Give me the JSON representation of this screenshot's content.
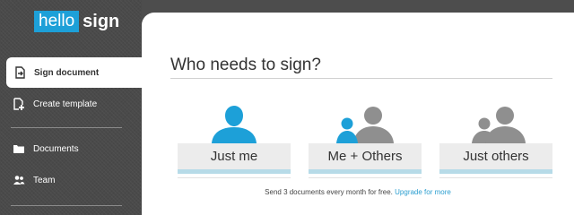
{
  "logo": {
    "box_text": "hello",
    "word_text": "sign"
  },
  "sidebar": {
    "items": [
      {
        "label": "Sign document",
        "icon": "sign-document-icon"
      },
      {
        "label": "Create template",
        "icon": "add-template-icon"
      },
      {
        "label": "Documents",
        "icon": "folder-icon"
      },
      {
        "label": "Team",
        "icon": "team-icon"
      }
    ]
  },
  "main": {
    "title": "Who needs to sign?",
    "options": [
      {
        "label": "Just me",
        "icon": "single-person-icon"
      },
      {
        "label": "Me + Others",
        "icon": "me-plus-others-icon"
      },
      {
        "label": "Just others",
        "icon": "others-icon"
      }
    ],
    "footer_text": "Send 3 documents every month for free.",
    "footer_link": "Upgrade for more"
  },
  "colors": {
    "accent": "#1da0d8",
    "figure_gray": "#8f8f8f",
    "sidebar_bg": "#4a4a4a",
    "option_bar": "#b7dbe8"
  }
}
